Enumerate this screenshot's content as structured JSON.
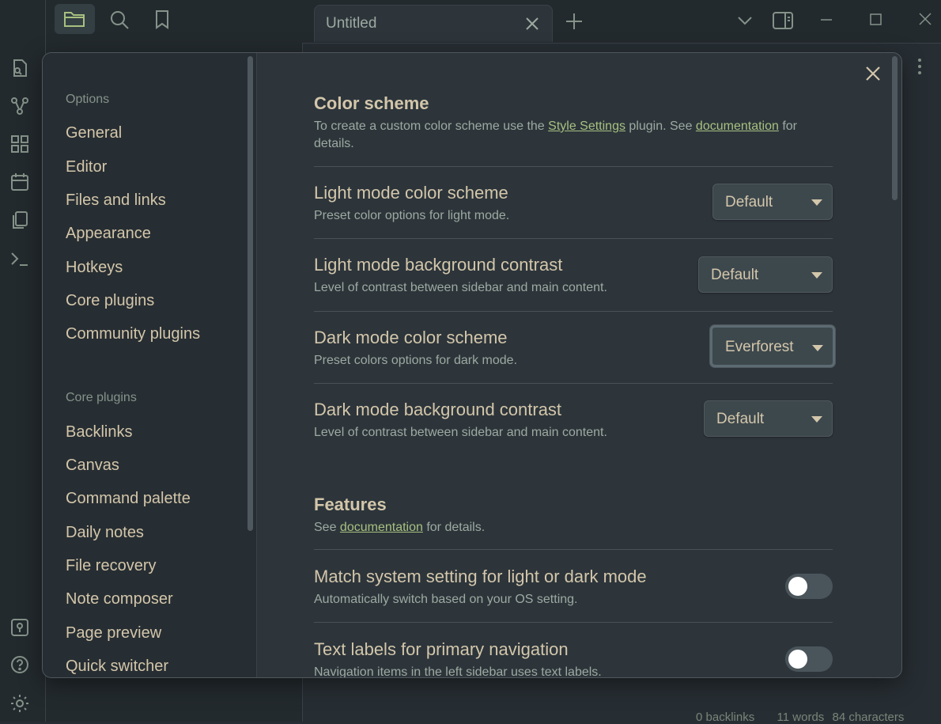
{
  "tab": {
    "title": "Untitled"
  },
  "status": {
    "backlinks": "0 backlinks",
    "words": "11 words",
    "characters": "84 characters"
  },
  "settings_nav": {
    "options_header": "Options",
    "options": [
      "General",
      "Editor",
      "Files and links",
      "Appearance",
      "Hotkeys",
      "Core plugins",
      "Community plugins"
    ],
    "core_header": "Core plugins",
    "core": [
      "Backlinks",
      "Canvas",
      "Command palette",
      "Daily notes",
      "File recovery",
      "Note composer",
      "Page preview",
      "Quick switcher"
    ]
  },
  "color_scheme": {
    "heading": "Color scheme",
    "desc_1": "To create a custom color scheme use the ",
    "link_style_settings": "Style Settings",
    "desc_2": " plugin. See ",
    "link_documentation": "documentation",
    "desc_3": " for details."
  },
  "settings": [
    {
      "title": "Light mode color scheme",
      "desc": "Preset color options for light mode.",
      "value": "Default"
    },
    {
      "title": "Light mode background contrast",
      "desc": "Level of contrast between sidebar and main content.",
      "value": "Default"
    },
    {
      "title": "Dark mode color scheme",
      "desc": "Preset colors options for dark mode.",
      "value": "Everforest"
    },
    {
      "title": "Dark mode background contrast",
      "desc": "Level of contrast between sidebar and main content.",
      "value": "Default"
    }
  ],
  "features": {
    "heading": "Features",
    "desc_1": "See ",
    "link_documentation": "documentation",
    "desc_2": " for details."
  },
  "toggles": [
    {
      "title": "Match system setting for light or dark mode",
      "desc": "Automatically switch based on your OS setting.",
      "on": false
    },
    {
      "title": "Text labels for primary navigation",
      "desc": "Navigation items in the left sidebar uses text labels.",
      "on": false
    }
  ],
  "colors": {
    "accent_link": "#a7c080",
    "background": "#2d353b",
    "sidebar": "#232a2e"
  },
  "icons": {
    "ribbon": [
      "sidebar-toggle-icon",
      "open-quick-switcher-icon",
      "graph-view-icon",
      "canvas-icon",
      "daily-note-icon",
      "templates-icon",
      "command-palette-icon",
      "vault-icon",
      "help-icon",
      "settings-icon"
    ],
    "top": [
      "folder-icon",
      "search-icon",
      "bookmark-icon",
      "new-tab-icon",
      "chevron-down-icon",
      "right-sidebar-icon",
      "minimize-icon",
      "maximize-icon",
      "close-window-icon",
      "more-options-icon"
    ]
  }
}
